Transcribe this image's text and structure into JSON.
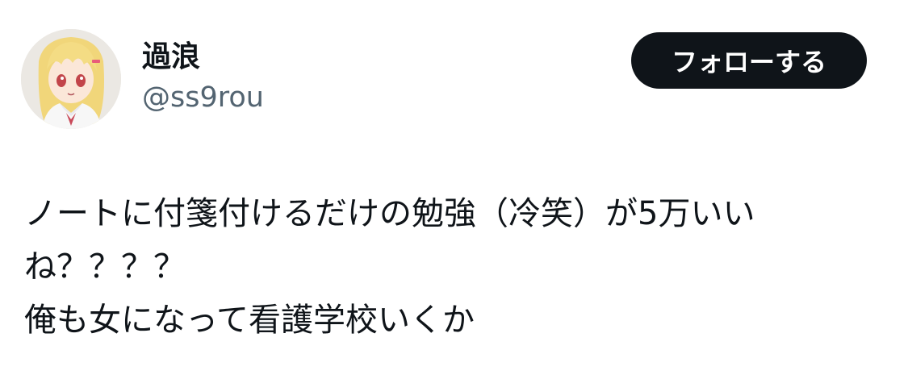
{
  "author": {
    "display_name": "過浪",
    "handle": "@ss9rou",
    "avatar_icon": "anime-girl-avatar-icon"
  },
  "actions": {
    "follow_label": "フォローする"
  },
  "tweet": {
    "lines": [
      "ノートに付箋付けるだけの勉強（冷笑）が5万いい",
      "ね？？？？",
      "俺も女になって看護学校いくか"
    ]
  },
  "colors": {
    "text_primary": "#0f1419",
    "text_secondary": "#536471",
    "button_bg": "#0f1419",
    "button_text": "#ffffff"
  }
}
